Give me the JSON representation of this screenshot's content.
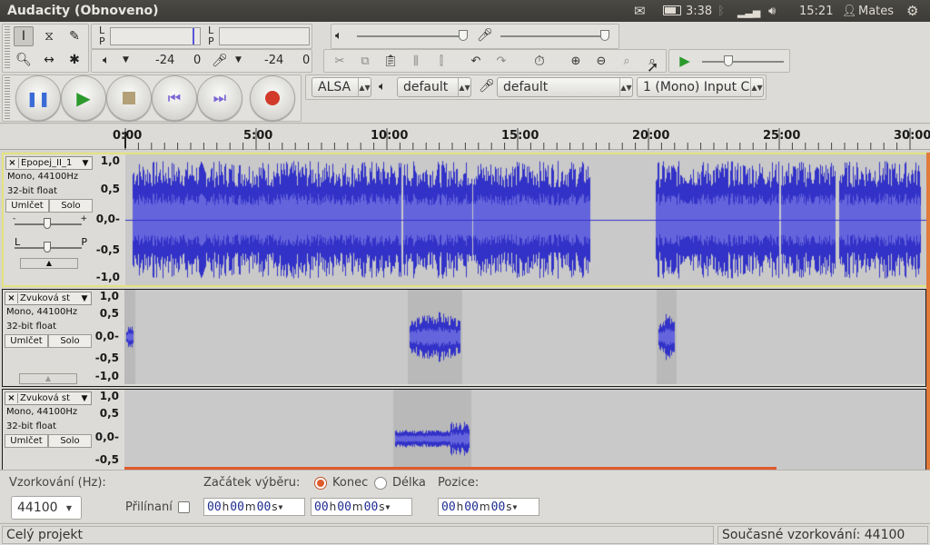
{
  "app": {
    "title": "Audacity (Obnoveno)"
  },
  "tray": {
    "battery_time": "3:38",
    "clock": "15:21",
    "user": "Mates"
  },
  "meter": {
    "L": "L",
    "P": "P",
    "rec_db_left": "-24",
    "rec_db_mid": "0",
    "play_db_left": "-24",
    "play_db_right": "0"
  },
  "device": {
    "host": "ALSA",
    "output": "default",
    "input": "default",
    "channels": "1 (Mono) Input C"
  },
  "ruler": {
    "labels": [
      "0:00",
      "5:00",
      "10:00",
      "15:00",
      "20:00",
      "25:00",
      "30:00"
    ]
  },
  "tracks": [
    {
      "name": "Epopej_II_1",
      "info1": "Mono, 44100Hz",
      "info2": "32-bit float",
      "mute": "Umlčet",
      "solo": "Solo",
      "pan_l": "L",
      "pan_r": "P",
      "gain_minus": "-",
      "gain_plus": "+",
      "scale": [
        "1,0",
        "0,5",
        "0,0-",
        "-0,5",
        "-1,0"
      ]
    },
    {
      "name": "Zvuková st",
      "info1": "Mono, 44100Hz",
      "info2": "32-bit float",
      "mute": "Umlčet",
      "solo": "Solo",
      "scale": [
        "1,0",
        "0,5",
        "0,0-",
        "-0,5",
        "-1,0"
      ]
    },
    {
      "name": "Zvuková st",
      "info1": "Mono, 44100Hz",
      "info2": "32-bit float",
      "mute": "Umlčet",
      "solo": "Solo",
      "scale": [
        "1,0",
        "0,5",
        "0,0-",
        "-0,5"
      ]
    }
  ],
  "selection": {
    "rate_label": "Vzorkování (Hz):",
    "rate_value": "44100",
    "snap_label": "Přilínaní",
    "start_label": "Začátek výběru:",
    "end_label": "Konec",
    "length_label": "Délka",
    "position_label": "Pozice:",
    "time_h": "00",
    "time_m": "00",
    "time_s": "00",
    "unit_h": "h",
    "unit_m": "m",
    "unit_s": "s"
  },
  "status": {
    "left": "Celý projekt",
    "right": "Současné vzorkování: 44100"
  },
  "colors": {
    "wave": "#3232c8",
    "wave_rms": "#6464dc",
    "accent": "#e05a2b",
    "selected_track": "#e3e37c"
  }
}
